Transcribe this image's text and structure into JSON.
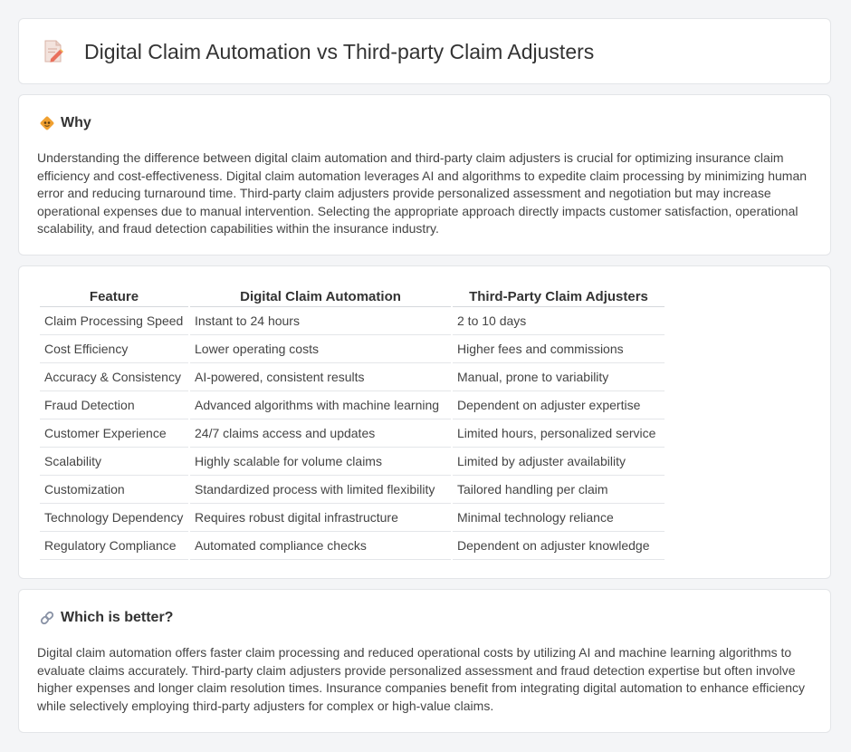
{
  "page": {
    "title": "Digital Claim Automation vs Third-party Claim Adjusters",
    "title_icon": "document-pencil-icon"
  },
  "why": {
    "icon": "diamond-warning-icon",
    "heading": "Why",
    "text": "Understanding the difference between digital claim automation and third-party claim adjusters is crucial for optimizing insurance claim efficiency and cost-effectiveness. Digital claim automation leverages AI and algorithms to expedite claim processing by minimizing human error and reducing turnaround time. Third-party claim adjusters provide personalized assessment and negotiation but may increase operational expenses due to manual intervention. Selecting the appropriate approach directly impacts customer satisfaction, operational scalability, and fraud detection capabilities within the insurance industry."
  },
  "table": {
    "headers": [
      "Feature",
      "Digital Claim Automation",
      "Third-Party Claim Adjusters"
    ],
    "rows": [
      [
        "Claim Processing Speed",
        "Instant to 24 hours",
        "2 to 10 days"
      ],
      [
        "Cost Efficiency",
        "Lower operating costs",
        "Higher fees and commissions"
      ],
      [
        "Accuracy & Consistency",
        "AI-powered, consistent results",
        "Manual, prone to variability"
      ],
      [
        "Fraud Detection",
        "Advanced algorithms with machine learning",
        "Dependent on adjuster expertise"
      ],
      [
        "Customer Experience",
        "24/7 claims access and updates",
        "Limited hours, personalized service"
      ],
      [
        "Scalability",
        "Highly scalable for volume claims",
        "Limited by adjuster availability"
      ],
      [
        "Customization",
        "Standardized process with limited flexibility",
        "Tailored handling per claim"
      ],
      [
        "Technology Dependency",
        "Requires robust digital infrastructure",
        "Minimal technology reliance"
      ],
      [
        "Regulatory Compliance",
        "Automated compliance checks",
        "Dependent on adjuster knowledge"
      ]
    ]
  },
  "better": {
    "icon": "link-icon",
    "heading": "Which is better?",
    "text": "Digital claim automation offers faster claim processing and reduced operational costs by utilizing AI and machine learning algorithms to evaluate claims accurately. Third-party claim adjusters provide personalized assessment and fraud detection expertise but often involve higher expenses and longer claim resolution times. Insurance companies benefit from integrating digital automation to enhance efficiency while selectively employing third-party adjusters for complex or high-value claims."
  },
  "colors": {
    "background": "#f4f5f7",
    "card": "#ffffff",
    "accent_orange": "#f0a030",
    "icon_pink": "#e9897e"
  }
}
